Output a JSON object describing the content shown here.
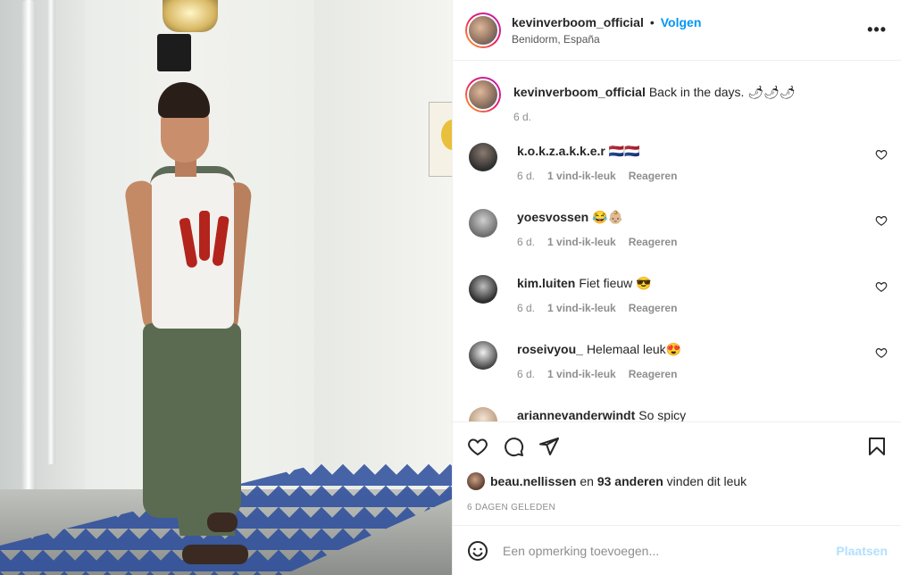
{
  "post": {
    "author": "kevinverboom_official",
    "follow_label": "Volgen",
    "dot": "•",
    "location": "Benidorm, España",
    "more_label": "•••"
  },
  "caption": {
    "user": "kevinverboom_official",
    "text": "Back in the days. 🌶🌶🌶",
    "time": "6 d."
  },
  "comments": [
    {
      "user": "k.o.k.z.a.k.k.e.r",
      "text": "🇳🇱🇳🇱",
      "time": "6 d.",
      "likes": "1 vind-ik-leuk",
      "reply": "Reageren",
      "avatar_color": "#3b3b3b"
    },
    {
      "user": "yoesvossen",
      "text": "😂👶🏼",
      "time": "6 d.",
      "likes": "1 vind-ik-leuk",
      "reply": "Reageren",
      "avatar_color": "#9a9a9a"
    },
    {
      "user": "kim.luiten",
      "text": "Fiet fieuw 😎",
      "time": "6 d.",
      "likes": "1 vind-ik-leuk",
      "reply": "Reageren",
      "avatar_color": "#555555"
    },
    {
      "user": "roseivyou_",
      "text": "Helemaal leuk😍",
      "time": "6 d.",
      "likes": "1 vind-ik-leuk",
      "reply": "Reageren",
      "avatar_color": "#d8d8d8"
    },
    {
      "user": "ariannevanderwindt",
      "text": "So spicy",
      "time": "",
      "likes": "",
      "reply": "",
      "avatar_color": "#e8d8c8"
    }
  ],
  "likes": {
    "user": "beau.nellissen",
    "middle": " en ",
    "others": "93 anderen",
    "suffix": " vinden dit leuk"
  },
  "time_ago": "6 DAGEN GELEDEN",
  "add_comment": {
    "placeholder": "Een opmerking toevoegen...",
    "post_label": "Plaatsen"
  },
  "colors": {
    "accent": "#0095f6",
    "post_disabled": "#b2dffc",
    "meta_grey": "#8e8e8e"
  },
  "icons": {
    "like": "heart-icon",
    "comment": "comment-icon",
    "share": "paper-plane-icon",
    "save": "bookmark-icon",
    "emoji": "emoji-icon",
    "more": "more-icon"
  }
}
